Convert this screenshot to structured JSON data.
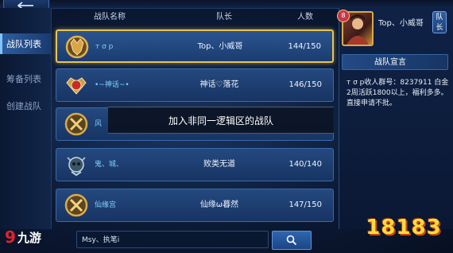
{
  "header": {
    "col_name": "战队名称",
    "col_leader": "队长",
    "col_count": "人数"
  },
  "sidebar": {
    "items": [
      {
        "label": "战队列表",
        "active": true
      },
      {
        "label": "筹备列表",
        "active": false
      },
      {
        "label": "创建战队",
        "active": false
      }
    ]
  },
  "teams": [
    {
      "name": "т σ р",
      "leader": "Top、小威哥",
      "count": "144/150",
      "selected": true,
      "badge_icon": "gold-wolf-emblem-icon"
    },
    {
      "name": "•~神话~•",
      "leader": "神话♡落花",
      "count": "146/150",
      "selected": false,
      "badge_icon": "red-gem-emblem-icon"
    },
    {
      "name": "风",
      "leader": "",
      "count": "",
      "selected": false,
      "badge_icon": "gold-wolf-emblem-icon"
    },
    {
      "name": "鬼、城、",
      "leader": "败类无道",
      "count": "140/140",
      "selected": false,
      "badge_icon": "skull-emblem-icon"
    },
    {
      "name": "仙缘宫",
      "leader": "仙缘ω暮然",
      "count": "147/150",
      "selected": false,
      "badge_icon": "gold-wolf-emblem-icon"
    }
  ],
  "toast": {
    "text": "加入非同一逻辑区的战队"
  },
  "captain": {
    "level": "8",
    "name": "Top、小威哥",
    "tag": "队长"
  },
  "declaration": {
    "title": "战队宣言",
    "text": "т σ р收人群号：8237911 白金2周活跃1800以上，福利多多。直接申请不批。"
  },
  "search": {
    "value": "Msy、执笔i"
  },
  "watermarks": {
    "left": "九游",
    "right": "18183"
  },
  "colors": {
    "selected_border": "#e8c451",
    "accent": "#7fd0ff"
  }
}
